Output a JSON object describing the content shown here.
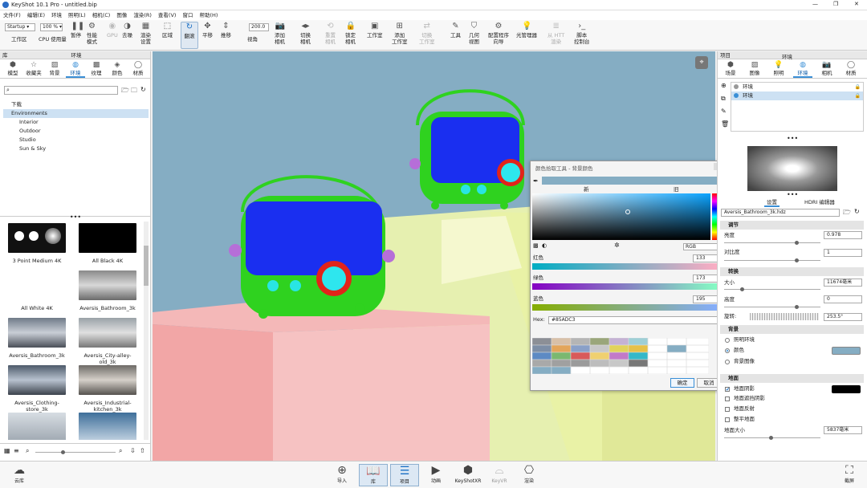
{
  "window": {
    "title": "KeyShot 10.1 Pro  - untitled.bip"
  },
  "menu": [
    "文件(F)",
    "编辑(E)",
    "环境",
    "照明(L)",
    "相机(C)",
    "图像",
    "渲染(R)",
    "查看(V)",
    "窗口",
    "帮助(H)"
  ],
  "toolbar": {
    "workspace": "Startup",
    "zoom": "100 %",
    "focal": "200.0",
    "items": [
      "工作区",
      "CPU 使用量",
      "暂停",
      "性能\n模式",
      "GPU",
      "去噪",
      "渲染\n设置",
      "区域",
      "翻滚",
      "平移",
      "推移",
      "视角",
      "添加\n相机",
      "切换\n相机",
      "重置\n相机",
      "锁定\n相机",
      "工作室",
      "添加\n工作室",
      "切换\n工作室",
      "工具",
      "几何\n视图",
      "配置程序\n向导",
      "光管理器",
      "从 HTT\n渲染",
      "脚本\n控制台"
    ]
  },
  "library": {
    "header": "库",
    "section": "环境",
    "tabs": [
      "模型",
      "收藏夹",
      "背景",
      "环境",
      "纹理",
      "颜色",
      "材质"
    ],
    "tree": [
      "下载",
      "Environments",
      "Interior",
      "Outdoor",
      "Studio",
      "Sun & Sky"
    ],
    "thumbs": [
      "3 Point Medium 4K",
      "All Black 4K",
      "All White 4K",
      "Aversis_Bathroom_3k",
      "Aversis_Bathroom_3k",
      "Aversis_City-alley-old_3k",
      "Aversis_Clothing-store_3k",
      "Aversis_Industrial-kitchen_3k"
    ]
  },
  "project": {
    "header": "项目",
    "section": "环境",
    "tabs": [
      "场景",
      "图像",
      "照明",
      "环境",
      "相机",
      "材质"
    ],
    "envlist": [
      "环境",
      "环境"
    ],
    "subtabs": [
      "设置",
      "HDRI 编辑器"
    ],
    "hdri_file": "Aversis_Bathroom_3k.hdz",
    "adjust": {
      "title": "调节",
      "brightness_label": "亮度",
      "brightness": "0.978",
      "contrast_label": "对比度",
      "contrast": "1"
    },
    "transform": {
      "title": "转换",
      "size_label": "大小",
      "size": "11674毫米",
      "height_label": "高度",
      "height": "0",
      "rotate_label": "旋转:",
      "rotate": "253.5°"
    },
    "background": {
      "title": "背景",
      "opts": [
        "照明环境",
        "颜色",
        "背景图像"
      ],
      "color": "#8AB3C9"
    },
    "ground": {
      "title": "地面",
      "opts": [
        "地面阴影",
        "地面遮挡阴影",
        "地面反射",
        "整平地面"
      ],
      "size_label": "地面大小",
      "size": "5837毫米"
    }
  },
  "picker": {
    "title": "颜色拾取工具 - 背景颜色",
    "new_label": "新",
    "old_label": "旧",
    "mode": "RGB",
    "r_label": "红色",
    "r": "133",
    "g_label": "绿色",
    "g": "173",
    "b_label": "蓝色",
    "b": "195",
    "hex_label": "Hex:",
    "hex": "#85ADC3",
    "ok": "确定",
    "cancel": "取消"
  },
  "bottom": {
    "cloud": "云库",
    "items": [
      "导入",
      "库",
      "项目",
      "动画",
      "KeyShotXR",
      "KeyVR",
      "渲染"
    ],
    "screenshot": "截屏"
  }
}
